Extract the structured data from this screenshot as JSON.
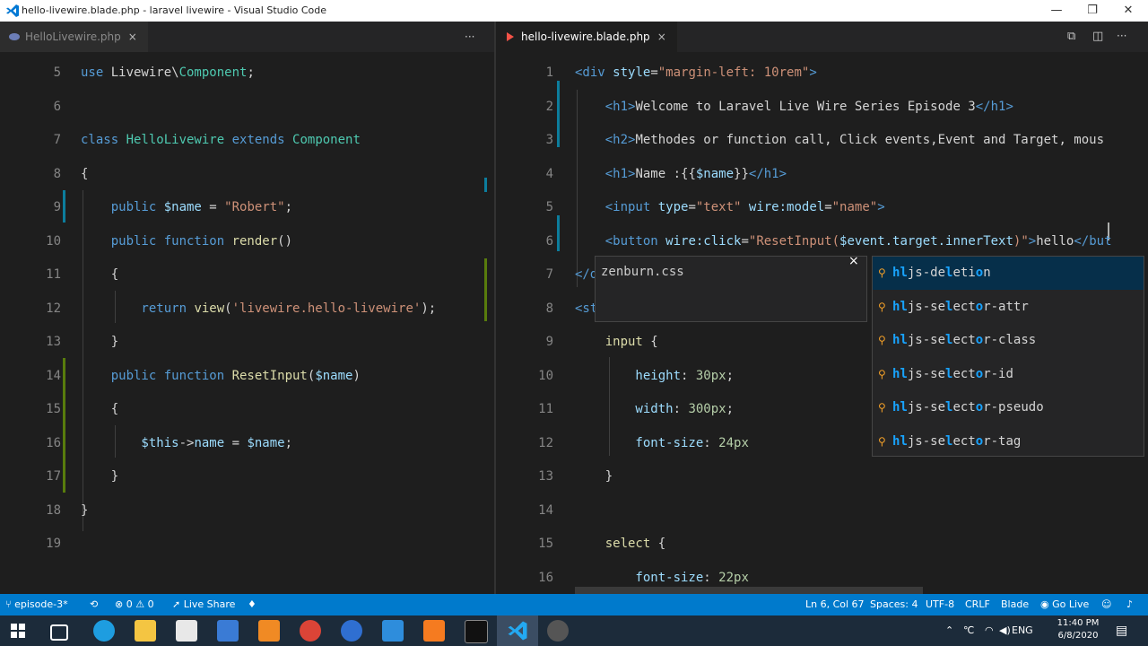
{
  "window": {
    "title": "hello-livewire.blade.php - laravel livewire - Visual Studio Code",
    "minimize": "—",
    "restore": "❐",
    "close": "✕"
  },
  "left_pane": {
    "tab_label": "HelloLivewire.php",
    "more_actions": "···",
    "lines": [
      {
        "n": "5",
        "segments": [
          {
            "t": "use ",
            "c": "kw"
          },
          {
            "t": "Livewire\\",
            "c": "txt"
          },
          {
            "t": "Component",
            "c": "ty"
          },
          {
            "t": ";",
            "c": "txt"
          }
        ]
      },
      {
        "n": "6",
        "segments": []
      },
      {
        "n": "7",
        "segments": [
          {
            "t": "class ",
            "c": "kw"
          },
          {
            "t": "HelloLivewire ",
            "c": "ty"
          },
          {
            "t": "extends ",
            "c": "kw"
          },
          {
            "t": "Component",
            "c": "ty"
          }
        ]
      },
      {
        "n": "8",
        "segments": [
          {
            "t": "{",
            "c": "txt"
          }
        ]
      },
      {
        "n": "9",
        "segments": [
          {
            "t": "    public ",
            "c": "kw"
          },
          {
            "t": "$name",
            "c": "var"
          },
          {
            "t": " = ",
            "c": "txt"
          },
          {
            "t": "\"Robert\"",
            "c": "str"
          },
          {
            "t": ";",
            "c": "txt"
          }
        ]
      },
      {
        "n": "10",
        "segments": [
          {
            "t": "    public ",
            "c": "kw"
          },
          {
            "t": "function ",
            "c": "kw"
          },
          {
            "t": "render",
            "c": "fn"
          },
          {
            "t": "()",
            "c": "txt"
          }
        ]
      },
      {
        "n": "11",
        "segments": [
          {
            "t": "    {",
            "c": "txt"
          }
        ]
      },
      {
        "n": "12",
        "segments": [
          {
            "t": "        return ",
            "c": "kw"
          },
          {
            "t": "view",
            "c": "fn"
          },
          {
            "t": "(",
            "c": "txt"
          },
          {
            "t": "'livewire.hello-livewire'",
            "c": "str"
          },
          {
            "t": ");",
            "c": "txt"
          }
        ]
      },
      {
        "n": "13",
        "segments": [
          {
            "t": "    }",
            "c": "txt"
          }
        ]
      },
      {
        "n": "14",
        "segments": [
          {
            "t": "    public ",
            "c": "kw"
          },
          {
            "t": "function ",
            "c": "kw"
          },
          {
            "t": "ResetInput",
            "c": "fn"
          },
          {
            "t": "(",
            "c": "txt"
          },
          {
            "t": "$name",
            "c": "var"
          },
          {
            "t": ")",
            "c": "txt"
          }
        ]
      },
      {
        "n": "15",
        "segments": [
          {
            "t": "    {",
            "c": "txt"
          }
        ]
      },
      {
        "n": "16",
        "segments": [
          {
            "t": "        $this",
            "c": "var"
          },
          {
            "t": "->",
            "c": "txt"
          },
          {
            "t": "name",
            "c": "var"
          },
          {
            "t": " = ",
            "c": "txt"
          },
          {
            "t": "$name",
            "c": "var"
          },
          {
            "t": ";",
            "c": "txt"
          }
        ]
      },
      {
        "n": "17",
        "segments": [
          {
            "t": "    }",
            "c": "txt"
          }
        ]
      },
      {
        "n": "18",
        "segments": [
          {
            "t": "}",
            "c": "txt"
          }
        ]
      },
      {
        "n": "19",
        "segments": []
      }
    ]
  },
  "right_pane": {
    "tab_label": "hello-livewire.blade.php",
    "lines": [
      {
        "n": "1",
        "segments": [
          {
            "t": "<div ",
            "c": "tag"
          },
          {
            "t": "style",
            "c": "attr"
          },
          {
            "t": "=",
            "c": "txt"
          },
          {
            "t": "\"margin-left: 10rem\"",
            "c": "str"
          },
          {
            "t": ">",
            "c": "tag"
          }
        ]
      },
      {
        "n": "2",
        "segments": [
          {
            "t": "    <h1>",
            "c": "tag"
          },
          {
            "t": "Welcome to Laravel Live Wire Series Episode 3",
            "c": "txt"
          },
          {
            "t": "</h1>",
            "c": "tag"
          }
        ]
      },
      {
        "n": "3",
        "segments": [
          {
            "t": "    <h2>",
            "c": "tag"
          },
          {
            "t": "Methodes or function call, Click events,Event and Target, mous",
            "c": "txt"
          }
        ]
      },
      {
        "n": "4",
        "segments": [
          {
            "t": "    <h1>",
            "c": "tag"
          },
          {
            "t": "Name :{{",
            "c": "txt"
          },
          {
            "t": "$name",
            "c": "var"
          },
          {
            "t": "}}",
            "c": "txt"
          },
          {
            "t": "</h1>",
            "c": "tag"
          }
        ]
      },
      {
        "n": "5",
        "segments": [
          {
            "t": "    <input ",
            "c": "tag"
          },
          {
            "t": "type",
            "c": "attr"
          },
          {
            "t": "=",
            "c": "txt"
          },
          {
            "t": "\"text\" ",
            "c": "str"
          },
          {
            "t": "wire:model",
            "c": "attr"
          },
          {
            "t": "=",
            "c": "txt"
          },
          {
            "t": "\"name\"",
            "c": "str"
          },
          {
            "t": ">",
            "c": "tag"
          }
        ]
      },
      {
        "n": "6",
        "segments": [
          {
            "t": "    <button ",
            "c": "tag"
          },
          {
            "t": "wire:click",
            "c": "attr"
          },
          {
            "t": "=",
            "c": "txt"
          },
          {
            "t": "\"ResetInput(",
            "c": "str"
          },
          {
            "t": "$event.target.innerText",
            "c": "var"
          },
          {
            "t": ")\"",
            "c": "str"
          },
          {
            "t": ">",
            "c": "tag"
          },
          {
            "t": "hello",
            "c": "txt"
          },
          {
            "t": "</but",
            "c": "tag"
          }
        ]
      },
      {
        "n": "7",
        "segments": [
          {
            "t": "</d",
            "c": "tag"
          }
        ]
      },
      {
        "n": "8",
        "segments": [
          {
            "t": "<st",
            "c": "tag"
          }
        ]
      },
      {
        "n": "9",
        "segments": [
          {
            "t": "    input ",
            "c": "fn"
          },
          {
            "t": "{",
            "c": "txt"
          }
        ]
      },
      {
        "n": "10",
        "segments": [
          {
            "t": "        height",
            "c": "prop"
          },
          {
            "t": ": ",
            "c": "txt"
          },
          {
            "t": "30px",
            "c": "num"
          },
          {
            "t": ";",
            "c": "txt"
          }
        ]
      },
      {
        "n": "11",
        "segments": [
          {
            "t": "        width",
            "c": "prop"
          },
          {
            "t": ": ",
            "c": "txt"
          },
          {
            "t": "300px",
            "c": "num"
          },
          {
            "t": ";",
            "c": "txt"
          }
        ]
      },
      {
        "n": "12",
        "segments": [
          {
            "t": "        font-size",
            "c": "prop"
          },
          {
            "t": ": ",
            "c": "txt"
          },
          {
            "t": "24px",
            "c": "num"
          }
        ]
      },
      {
        "n": "13",
        "segments": [
          {
            "t": "    }",
            "c": "txt"
          }
        ]
      },
      {
        "n": "14",
        "segments": []
      },
      {
        "n": "15",
        "segments": [
          {
            "t": "    select ",
            "c": "fn"
          },
          {
            "t": "{",
            "c": "txt"
          }
        ]
      },
      {
        "n": "16",
        "segments": [
          {
            "t": "        font-size",
            "c": "prop"
          },
          {
            "t": ": ",
            "c": "txt"
          },
          {
            "t": "22px",
            "c": "num"
          }
        ]
      }
    ]
  },
  "suggest": {
    "details_title": "zenburn.css",
    "details_close": "×",
    "items": [
      {
        "pre": "h",
        "mid": "l",
        "rest": "js-de",
        "hl2": "l",
        "rest2": "eti",
        "hl3": "o",
        "rest3": "n"
      },
      {
        "pre": "h",
        "mid": "l",
        "rest": "js-se",
        "hl2": "l",
        "rest2": "ect",
        "hl3": "o",
        "rest3": "r-attr"
      },
      {
        "pre": "h",
        "mid": "l",
        "rest": "js-se",
        "hl2": "l",
        "rest2": "ect",
        "hl3": "o",
        "rest3": "r-class"
      },
      {
        "pre": "h",
        "mid": "l",
        "rest": "js-se",
        "hl2": "l",
        "rest2": "ect",
        "hl3": "o",
        "rest3": "r-id"
      },
      {
        "pre": "h",
        "mid": "l",
        "rest": "js-se",
        "hl2": "l",
        "rest2": "ect",
        "hl3": "o",
        "rest3": "r-pseudo"
      },
      {
        "pre": "h",
        "mid": "l",
        "rest": "js-se",
        "hl2": "l",
        "rest2": "ect",
        "hl3": "o",
        "rest3": "r-tag"
      }
    ]
  },
  "statusbar": {
    "branch": "episode-3*",
    "problems": "⊗ 0 ⚠ 0",
    "live_share": "Live Share",
    "position": "Ln 6, Col 67",
    "spaces": "Spaces: 4",
    "encoding": "UTF-8",
    "eol": "CRLF",
    "language": "Blade",
    "go_live": "Go Live"
  },
  "taskbar": {
    "language": "ENG",
    "time": "11:40 PM",
    "date": "6/8/2020"
  },
  "colors": {
    "status_blue": "#007acc",
    "editor_bg": "#1e1e1e",
    "suggest_selected": "#062f4a"
  }
}
